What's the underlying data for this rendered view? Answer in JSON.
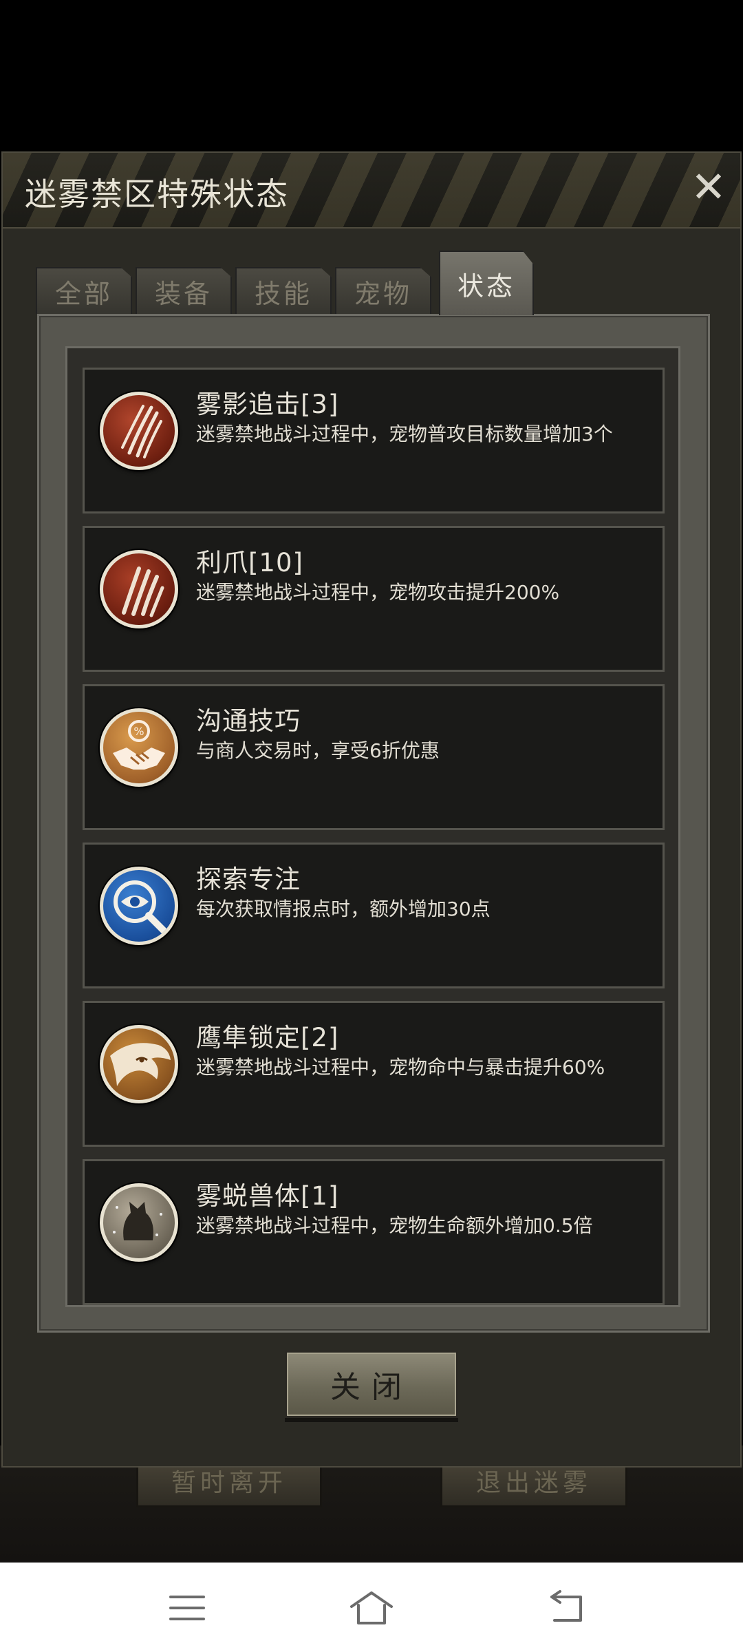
{
  "background": {
    "left_button": "暂时离开",
    "right_button": "退出迷雾"
  },
  "dialog": {
    "title": "迷雾禁区特殊状态",
    "close_icon": "close-icon",
    "tabs": [
      {
        "label": "全部",
        "active": false
      },
      {
        "label": "装备",
        "active": false
      },
      {
        "label": "技能",
        "active": false
      },
      {
        "label": "宠物",
        "active": false
      },
      {
        "label": "状态",
        "active": true
      }
    ],
    "items": [
      {
        "name": "雾影追击[3]",
        "desc": "迷雾禁地战斗过程中，宠物普攻目标数量增加3个",
        "icon": "claw-slash-icon"
      },
      {
        "name": "利爪[10]",
        "desc": "迷雾禁地战斗过程中，宠物攻击提升200%",
        "icon": "claws-icon"
      },
      {
        "name": "沟通技巧",
        "desc": "与商人交易时，享受6折优惠",
        "icon": "handshake-discount-icon"
      },
      {
        "name": "探索专注",
        "desc": "每次获取情报点时，额外增加30点",
        "icon": "eye-magnifier-icon"
      },
      {
        "name": "鹰隼锁定[2]",
        "desc": "迷雾禁地战斗过程中，宠物命中与暴击提升60%",
        "icon": "eagle-icon"
      },
      {
        "name": "雾蜕兽体[1]",
        "desc": "迷雾禁地战斗过程中，宠物生命额外增加0.5倍",
        "icon": "wolf-icon"
      }
    ],
    "close_button": "关闭"
  },
  "colors": {
    "dialog_bg": "#2b2a24",
    "item_bg": "#1a1a18",
    "text": "#e7e3d8"
  },
  "nav": {
    "menu_icon": "menu-icon",
    "home_icon": "home-icon",
    "back_icon": "back-icon"
  }
}
